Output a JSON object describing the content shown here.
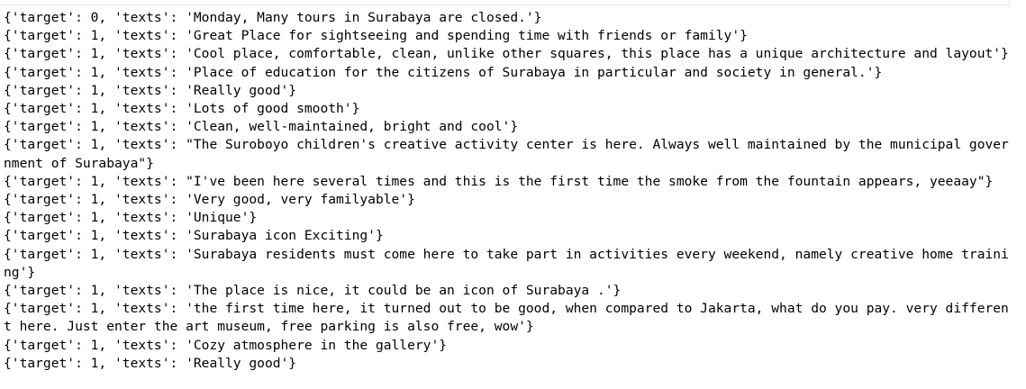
{
  "output": {
    "lines": [
      "{'target': 0, 'texts': 'Monday, Many tours in Surabaya are closed.'}",
      "{'target': 1, 'texts': 'Great Place for sightseeing and spending time with friends or family'}",
      "{'target': 1, 'texts': 'Cool place, comfortable, clean, unlike other squares, this place has a unique architecture and layout'}",
      "{'target': 1, 'texts': 'Place of education for the citizens of Surabaya in particular and society in general.'}",
      "{'target': 1, 'texts': 'Really good'}",
      "{'target': 1, 'texts': 'Lots of good smooth'}",
      "{'target': 1, 'texts': 'Clean, well-maintained, bright and cool'}",
      "{'target': 1, 'texts': \"The Suroboyo children's creative activity center is here. Always well maintained by the municipal government of Surabaya\"}",
      "{'target': 1, 'texts': \"I've been here several times and this is the first time the smoke from the fountain appears, yeeaay\"}",
      "{'target': 1, 'texts': 'Very good, very familyable'}",
      "{'target': 1, 'texts': 'Unique'}",
      "{'target': 1, 'texts': 'Surabaya icon Exciting'}",
      "{'target': 1, 'texts': 'Surabaya residents must come here to take part in activities every weekend, namely creative home training'}",
      "{'target': 1, 'texts': 'The place is nice, it could be an icon of Surabaya .'}",
      "{'target': 1, 'texts': 'the first time here, it turned out to be good, when compared to Jakarta, what do you pay. very different here. Just enter the art museum, free parking is also free, wow'}",
      "{'target': 1, 'texts': 'Cozy atmosphere in the gallery'}",
      "{'target': 1, 'texts': 'Really good'}"
    ]
  }
}
